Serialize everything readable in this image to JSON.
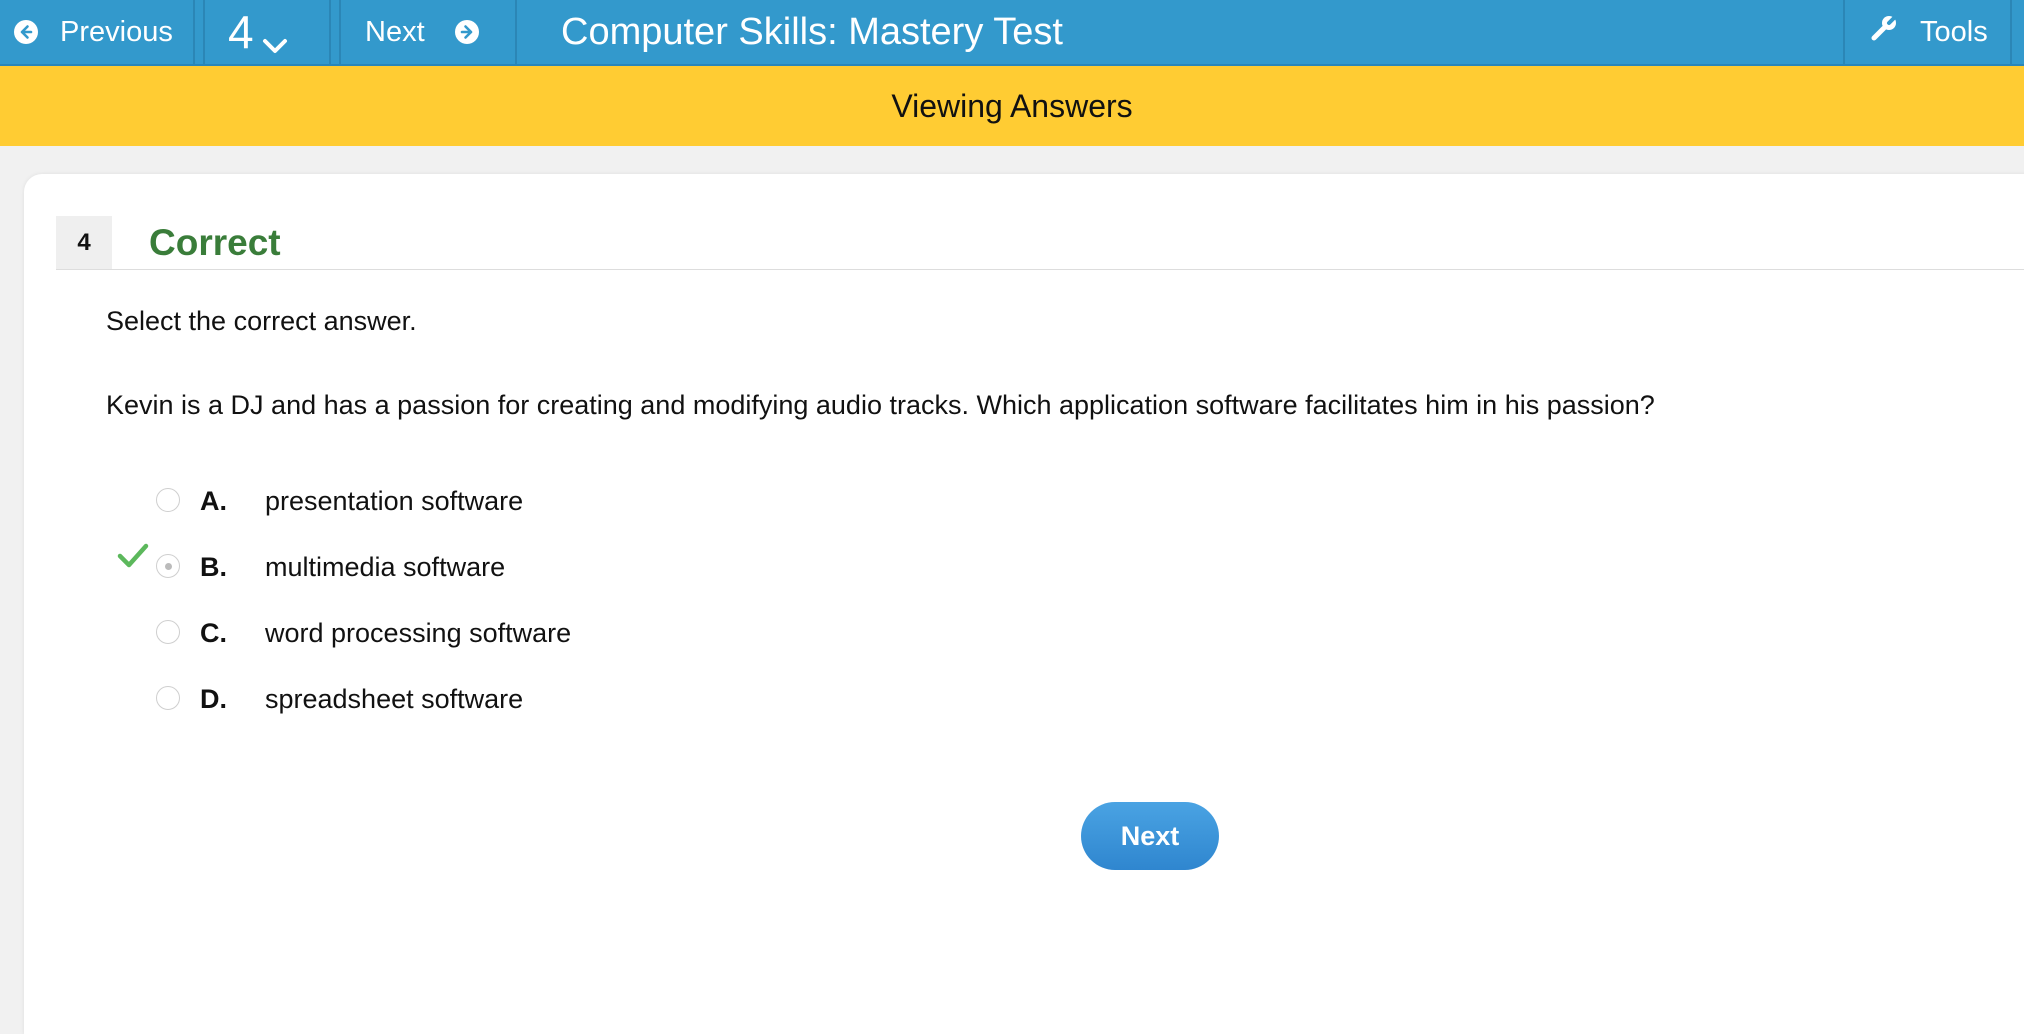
{
  "topbar": {
    "previous_label": "Previous",
    "question_number": "4",
    "next_label": "Next",
    "title": "Computer Skills: Mastery Test",
    "tools_label": "Tools"
  },
  "banner": {
    "text": "Viewing Answers"
  },
  "question": {
    "number": "4",
    "status": "Correct",
    "instruction": "Select the correct answer.",
    "text": "Kevin is a DJ and has a passion for creating and modifying audio tracks. Which application software facilitates him in his passion?",
    "options": [
      {
        "letter": "A.",
        "text": "presentation software",
        "selected": false,
        "correct_mark": false
      },
      {
        "letter": "B.",
        "text": "multimedia software",
        "selected": true,
        "correct_mark": true
      },
      {
        "letter": "C.",
        "text": "word processing software",
        "selected": false,
        "correct_mark": false
      },
      {
        "letter": "D.",
        "text": "spreadsheet software",
        "selected": false,
        "correct_mark": false
      }
    ]
  },
  "next_button": {
    "label": "Next"
  },
  "colors": {
    "topbar": "#3399cc",
    "banner": "#ffcc33",
    "correct_green": "#3a7d3a",
    "check_green": "#5cb85c",
    "button_blue": "#3a92d8"
  },
  "icons": {
    "previous": "arrow-left-circle-icon",
    "question_dropdown": "chevron-down-icon",
    "next": "arrow-right-circle-icon",
    "tools": "wrench-icon",
    "correct": "checkmark-icon"
  }
}
